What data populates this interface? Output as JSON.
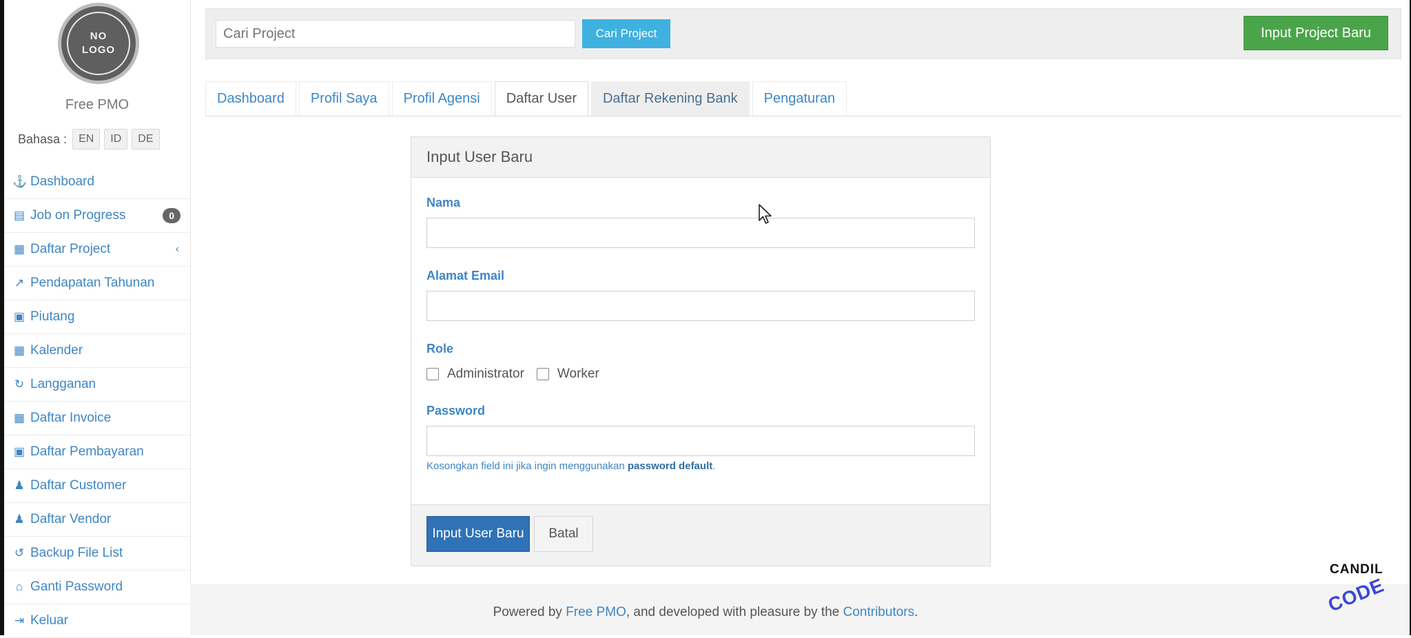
{
  "sidebar": {
    "logo": {
      "line1": "NO",
      "line2": "LOGO"
    },
    "brand": "Free PMO",
    "language_label": "Bahasa :",
    "languages": [
      "EN",
      "ID",
      "DE"
    ],
    "items": [
      {
        "label": "Dashboard",
        "icon": "dashboard-icon",
        "glyph": "⚓"
      },
      {
        "label": "Job on Progress",
        "icon": "list-icon",
        "glyph": "▤",
        "badge": "0"
      },
      {
        "label": "Daftar Project",
        "icon": "table-icon",
        "glyph": "▦",
        "caret": "‹"
      },
      {
        "label": "Pendapatan Tahunan",
        "icon": "line-chart-icon",
        "glyph": "↗"
      },
      {
        "label": "Piutang",
        "icon": "money-icon",
        "glyph": "▣"
      },
      {
        "label": "Kalender",
        "icon": "calendar-icon",
        "glyph": "▦"
      },
      {
        "label": "Langganan",
        "icon": "retweet-icon",
        "glyph": "↻"
      },
      {
        "label": "Daftar Invoice",
        "icon": "table-icon",
        "glyph": "▦"
      },
      {
        "label": "Daftar Pembayaran",
        "icon": "money-icon",
        "glyph": "▣"
      },
      {
        "label": "Daftar Customer",
        "icon": "users-icon",
        "glyph": "♟"
      },
      {
        "label": "Daftar Vendor",
        "icon": "users-icon",
        "glyph": "♟"
      },
      {
        "label": "Backup File List",
        "icon": "refresh-icon",
        "glyph": "↺"
      },
      {
        "label": "Ganti Password",
        "icon": "lock-icon",
        "glyph": "⌂"
      },
      {
        "label": "Keluar",
        "icon": "sign-out-icon",
        "glyph": "⇥"
      }
    ]
  },
  "topbar": {
    "search_placeholder": "Cari Project",
    "search_button": "Cari Project",
    "new_project_button": "Input Project Baru"
  },
  "tabs": [
    {
      "label": "Dashboard",
      "state": "normal"
    },
    {
      "label": "Profil Saya",
      "state": "normal"
    },
    {
      "label": "Profil Agensi",
      "state": "normal"
    },
    {
      "label": "Daftar User",
      "state": "active"
    },
    {
      "label": "Daftar Rekening Bank",
      "state": "hover"
    },
    {
      "label": "Pengaturan",
      "state": "normal"
    }
  ],
  "form": {
    "heading": "Input User Baru",
    "name_label": "Nama",
    "name_value": "",
    "email_label": "Alamat Email",
    "email_value": "",
    "role_label": "Role",
    "roles": [
      {
        "label": "Administrator",
        "checked": false
      },
      {
        "label": "Worker",
        "checked": false
      }
    ],
    "password_label": "Password",
    "password_value": "",
    "help_prefix": "Kosongkan field ini jika ingin menggunakan ",
    "help_bold": "password default",
    "help_suffix": ".",
    "submit_button": "Input User Baru",
    "cancel_button": "Batal"
  },
  "footer": {
    "part1": "Powered by ",
    "link1": "Free PMO",
    "part2": ", and developed with pleasure by the ",
    "link2": "Contributors",
    "part3": "."
  },
  "watermark": {
    "top": "CANDIL",
    "bottom": "CODE"
  },
  "colors": {
    "link_blue": "#3f86c4",
    "search_button": "#3fb1e0",
    "new_project_button": "#4aa54a",
    "submit_button": "#2f72b6",
    "badge": "#666666"
  }
}
